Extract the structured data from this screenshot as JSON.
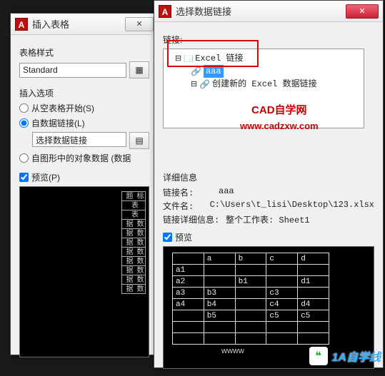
{
  "left": {
    "title": "插入表格",
    "style_label": "表格样式",
    "style_value": "Standard",
    "insert_label": "插入选项",
    "opt_blank": "从空表格开始(S)",
    "opt_link": "自数据链接(L)",
    "link_value": "选择数据链接",
    "opt_extract": "自图形中的对象数据 (数据",
    "preview_label": "预览(P)",
    "mini_headers": [
      "标题",
      "表",
      "表",
      "数据",
      "数据",
      "数据",
      "数据",
      "数据",
      "数据",
      "数据",
      "数据"
    ]
  },
  "right": {
    "title": "选择数据链接",
    "links_label": "链接:",
    "tree": {
      "root": "Excel 链接",
      "selected": "aaa",
      "create": "创建新的 Excel 数据链接"
    },
    "watermark_title": "CAD自学网",
    "watermark_url": "www.cadzxw.com",
    "details_label": "详细信息",
    "rows": [
      {
        "k": "链接名:",
        "v": "aaa"
      },
      {
        "k": "文件名:",
        "v": "C:\\Users\\t_lisi\\Desktop\\123.xlsx"
      },
      {
        "k": "链接详细信息:",
        "v": "整个工作表: Sheet1"
      }
    ],
    "preview_label": "预览"
  },
  "chart_data": {
    "type": "table",
    "headers": [
      "",
      "a",
      "b",
      "c",
      "d"
    ],
    "rows": [
      [
        "a1",
        "",
        "",
        "",
        ""
      ],
      [
        "a2",
        "",
        "b1",
        "",
        "d1"
      ],
      [
        "a3",
        "b3",
        "",
        "c3",
        ""
      ],
      [
        "a4",
        "b4",
        "",
        "c4",
        "d4"
      ],
      [
        "",
        "b5",
        "",
        "c5",
        "c5"
      ],
      [
        "",
        "",
        "",
        "",
        ""
      ],
      [
        "",
        "",
        "",
        "",
        ""
      ]
    ]
  },
  "brand": "1A自学线",
  "wwww": "wwww"
}
